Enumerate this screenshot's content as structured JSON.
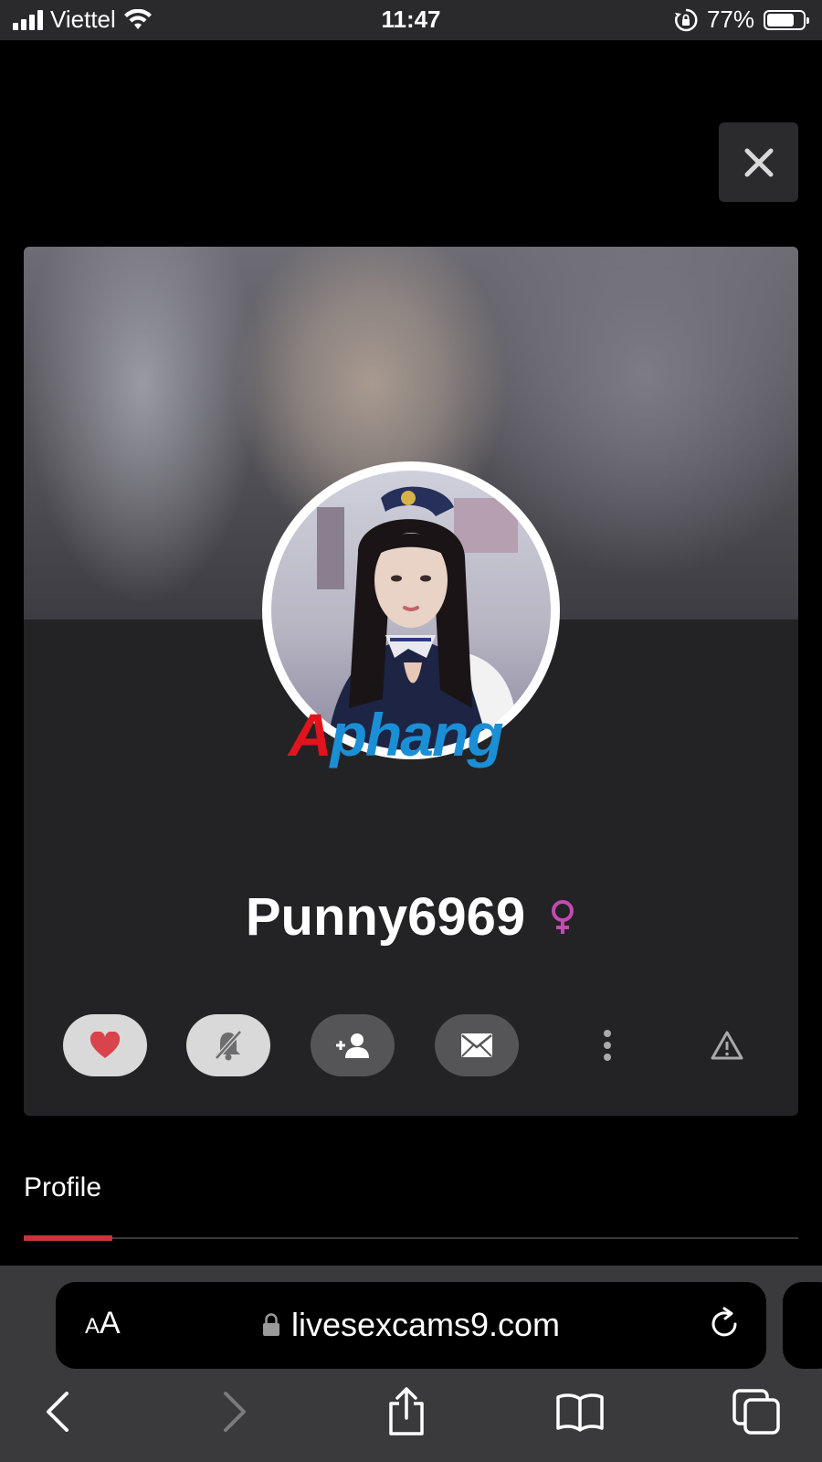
{
  "status_bar": {
    "carrier": "Viettel",
    "time": "11:47",
    "battery_percent": "77%",
    "battery_level": 0.77
  },
  "profile": {
    "username": "Punny6969",
    "gender_symbol": "♀",
    "watermark_part1": "A",
    "watermark_part2": "phang"
  },
  "actions": {
    "icons": [
      "heart-icon",
      "bell-muted-icon",
      "add-user-icon",
      "envelope-icon",
      "more-vertical-icon",
      "warning-icon"
    ]
  },
  "tabs": [
    {
      "label": "Profile",
      "active": true
    }
  ],
  "browser": {
    "aa_small": "A",
    "aa_large": "A",
    "url": "livesexcams9.com"
  },
  "colors": {
    "accent_red": "#c8353a",
    "heart": "#d9434b",
    "gender_pink": "#c24bb0"
  }
}
